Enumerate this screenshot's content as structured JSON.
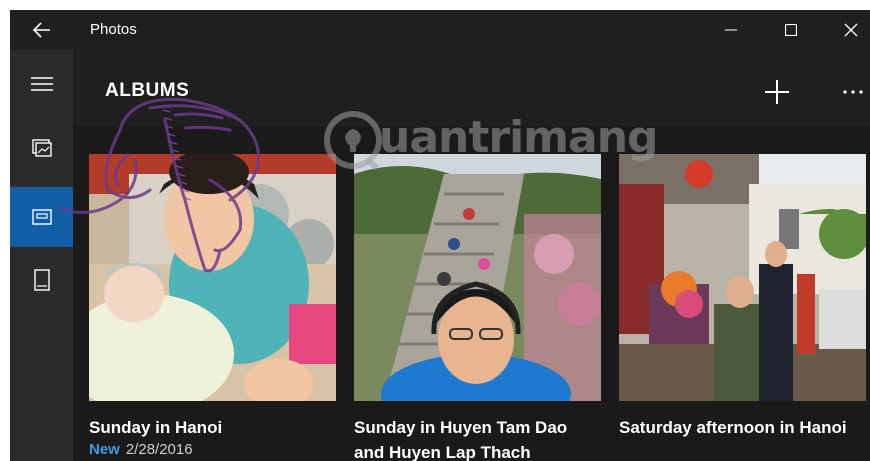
{
  "window": {
    "title": "Photos"
  },
  "header": {
    "title": "ALBUMS"
  },
  "icons": {
    "back": "back-arrow-icon",
    "minimize": "minimize-icon",
    "maximize": "maximize-icon",
    "close": "close-icon",
    "menu": "hamburger-menu-icon",
    "collection": "collection-icon",
    "albums": "albums-icon",
    "folders": "folders-icon",
    "add": "plus-icon",
    "more": "more-ellipsis-icon"
  },
  "watermark": {
    "text": "uantrimang"
  },
  "albums": [
    {
      "name": "Sunday in Hanoi",
      "badge": "New",
      "date": "2/28/2016"
    },
    {
      "name": "Sunday in Huyen Tam Dao and Huyen Lap Thach"
    },
    {
      "name": "Saturday afternoon in Hanoi"
    }
  ],
  "colors": {
    "accent": "#0f5ea6",
    "new_badge": "#3a9ee8",
    "background": "#1a1a1a",
    "rail": "#2b2b2b"
  }
}
